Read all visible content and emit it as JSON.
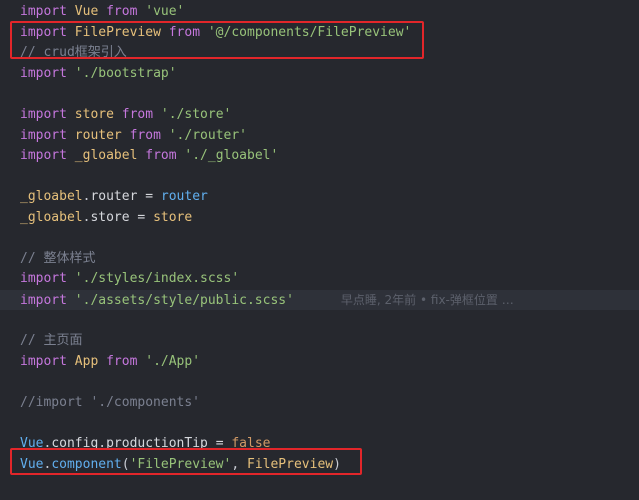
{
  "code": {
    "line01": {
      "kw1": "import",
      "name": "Vue",
      "kw2": "from",
      "src": "'vue'"
    },
    "line02": {
      "kw1": "import",
      "name": "FilePreview",
      "kw2": "from",
      "src": "'@/components/FilePreview'"
    },
    "line03": {
      "comment": "// crud框架引入"
    },
    "line04": {
      "kw1": "import",
      "src": "'./bootstrap'"
    },
    "line06": {
      "kw1": "import",
      "name": "store",
      "kw2": "from",
      "src": "'./store'"
    },
    "line07": {
      "kw1": "import",
      "name": "router",
      "kw2": "from",
      "src": "'./router'"
    },
    "line08": {
      "kw1": "import",
      "name": "_gloabel",
      "kw2": "from",
      "src": "'./_gloabel'"
    },
    "line10": {
      "obj": "_gloabel",
      "prop": "router",
      "op": "=",
      "val": "router"
    },
    "line11": {
      "obj": "_gloabel",
      "prop": "store",
      "op": "=",
      "val": "store"
    },
    "line13": {
      "comment": "// 整体样式"
    },
    "line14": {
      "kw1": "import",
      "src": "'./styles/index.scss'"
    },
    "line15": {
      "kw1": "import",
      "src": "'./assets/style/public.scss'",
      "blame": "早点睡, 2年前 • fix-弹框位置 …"
    },
    "line17": {
      "comment": "// 主页面"
    },
    "line18": {
      "kw1": "import",
      "name": "App",
      "kw2": "from",
      "src": "'./App'"
    },
    "line20": {
      "comment": "//import './components'"
    },
    "line22": {
      "obj": "Vue",
      "mid": "config",
      "prop": "productionTip",
      "op": "=",
      "val": "false"
    },
    "line23": {
      "obj": "Vue",
      "method": "component",
      "arg1": "'FilePreview'",
      "arg2": "FilePreview"
    }
  },
  "colors": {
    "background": "#26282e",
    "current_line": "#2e3139",
    "keyword": "#c577dd",
    "string": "#98c37a",
    "comment": "#7b8090",
    "highlight_box": "#e2262a"
  }
}
